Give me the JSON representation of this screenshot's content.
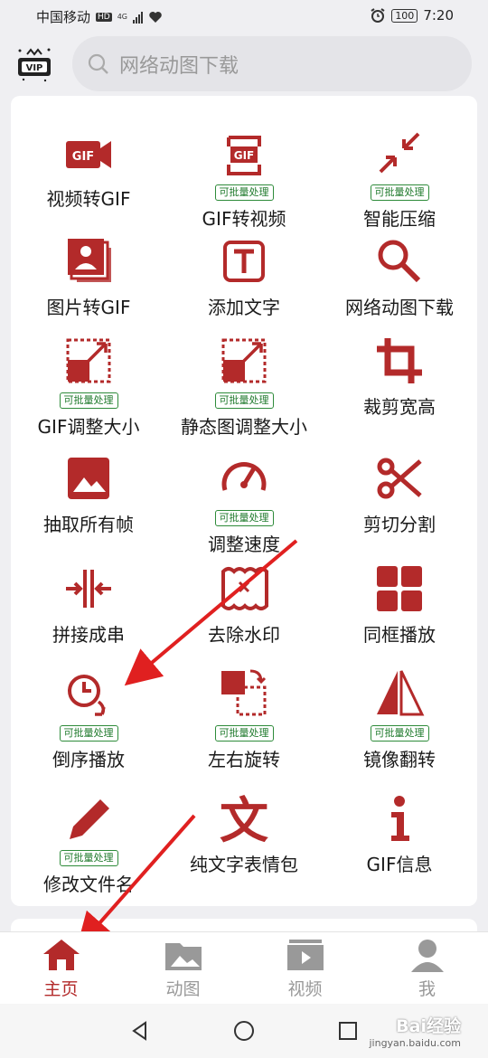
{
  "status": {
    "carrier": "中国移动",
    "hd": "HD",
    "network": "4G",
    "battery": "100",
    "time": "7:20"
  },
  "header": {
    "logo_text": "VIP",
    "search_placeholder": "网络动图下载"
  },
  "badge_text": "可批量处理",
  "tools": [
    {
      "label": "视频转GIF",
      "icon": "video-to-gif-icon",
      "batch": false
    },
    {
      "label": "GIF转视频",
      "icon": "gif-to-video-icon",
      "batch": true
    },
    {
      "label": "智能压缩",
      "icon": "compress-icon",
      "batch": true
    },
    {
      "label": "图片转GIF",
      "icon": "images-to-gif-icon",
      "batch": false
    },
    {
      "label": "添加文字",
      "icon": "add-text-icon",
      "batch": false
    },
    {
      "label": "网络动图下载",
      "icon": "search-download-icon",
      "batch": false
    },
    {
      "label": "GIF调整大小",
      "icon": "resize-icon",
      "batch": true
    },
    {
      "label": "静态图调整大小",
      "icon": "resize-static-icon",
      "batch": true
    },
    {
      "label": "裁剪宽高",
      "icon": "crop-icon",
      "batch": false
    },
    {
      "label": "抽取所有帧",
      "icon": "extract-frames-icon",
      "batch": false
    },
    {
      "label": "调整速度",
      "icon": "speed-icon",
      "batch": true
    },
    {
      "label": "剪切分割",
      "icon": "scissors-icon",
      "batch": false
    },
    {
      "label": "拼接成串",
      "icon": "join-icon",
      "batch": false
    },
    {
      "label": "去除水印",
      "icon": "remove-watermark-icon",
      "batch": false
    },
    {
      "label": "同框播放",
      "icon": "grid-play-icon",
      "batch": false
    },
    {
      "label": "倒序播放",
      "icon": "reverse-play-icon",
      "batch": true
    },
    {
      "label": "左右旋转",
      "icon": "rotate-icon",
      "batch": true
    },
    {
      "label": "镜像翻转",
      "icon": "mirror-icon",
      "batch": true
    },
    {
      "label": "修改文件名",
      "icon": "rename-icon",
      "batch": true
    },
    {
      "label": "纯文字表情包",
      "icon": "text-emoji-icon",
      "batch": false
    },
    {
      "label": "GIF信息",
      "icon": "info-icon",
      "batch": false
    }
  ],
  "tabs": [
    {
      "label": "主页",
      "icon": "home-icon",
      "active": true
    },
    {
      "label": "动图",
      "icon": "gif-folder-icon",
      "active": false
    },
    {
      "label": "视频",
      "icon": "video-icon",
      "active": false
    },
    {
      "label": "我",
      "icon": "profile-icon",
      "active": false
    }
  ],
  "watermark": {
    "brand": "Bai经验",
    "url": "jingyan.baidu.com"
  },
  "colors": {
    "accent": "#b32a2a",
    "badge_green": "#2e8b3a",
    "arrow": "#e02020"
  }
}
